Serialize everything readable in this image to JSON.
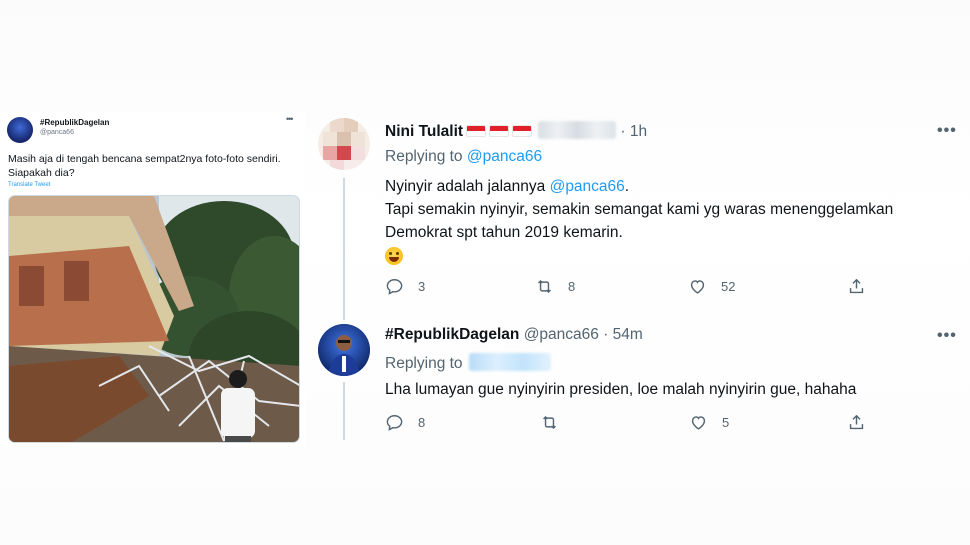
{
  "embedded_tweet": {
    "name": "#RepublikDagelan",
    "handle": "@panca66",
    "more": "•••",
    "text": "Masih aja di tengah bencana sempat2nya foto-foto sendiri. Siapakah dia?",
    "translate": "Translate Tweet"
  },
  "reply1": {
    "name": "Nini Tulalit",
    "time": "· 1h",
    "more": "•••",
    "replying_label": "Replying to",
    "replying_to": "@panca66",
    "line1_pre": "Nyinyir adalah jalannya ",
    "line1_mention": "@panca66",
    "line1_post": ".",
    "line2": "Tapi semakin nyinyir, semakin semangat kami yg waras menenggelamkan",
    "line3": "Demokrat spt tahun 2019 kemarin.",
    "stats": {
      "replies": "3",
      "retweets": "8",
      "likes": "52"
    }
  },
  "reply2": {
    "name": "#RepublikDagelan",
    "handle": "@panca66",
    "time": "· 54m",
    "more": "•••",
    "replying_label": "Replying to",
    "text": "Lha lumayan gue nyinyirin presiden, loe malah nyinyirin gue, hahaha",
    "stats": {
      "replies": "8",
      "retweets": "",
      "likes": "5"
    }
  },
  "icons": [
    "reply-icon",
    "retweet-icon",
    "like-icon",
    "share-icon",
    "more-icon"
  ],
  "colors": {
    "accent": "#1d9bf0",
    "muted": "#536471",
    "text": "#0f1419"
  }
}
